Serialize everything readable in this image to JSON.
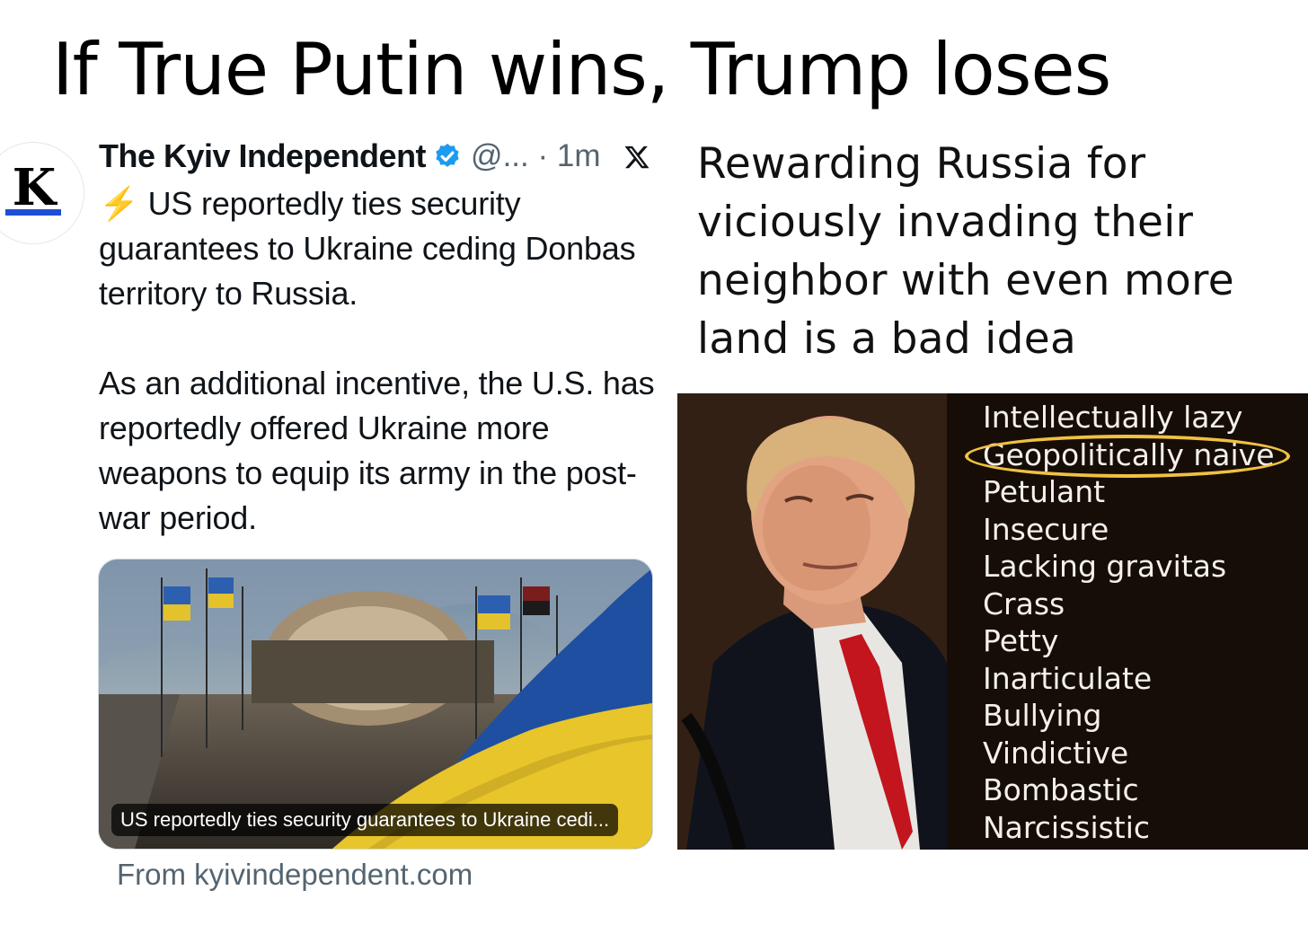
{
  "headline": "If True Putin wins, Trump loses",
  "tweet": {
    "avatar_letter": "K",
    "author": "The Kyiv Independent",
    "handle_time": "@... · 1m",
    "icons": [
      "verified-badge-icon",
      "x-logo-icon",
      "lightning-bolt-icon"
    ],
    "bolt": "⚡",
    "paragraph_1": "US reportedly ties security guarantees to Ukraine ceding Donbas territory to Russia.",
    "paragraph_2": "As an additional incentive, the U.S. has reportedly offered Ukraine more weapons to equip its army in the post-war period.",
    "card": {
      "caption": "US reportedly ties security guarantees to Ukraine cedi...",
      "source": "From kyivindependent.com"
    }
  },
  "quote": "Rewarding Russia for viciously invading their neighbor with even more land is a bad idea",
  "traits": {
    "items": [
      "Intellectually lazy",
      "Geopolitically naive",
      "Petulant",
      "Insecure",
      "Lacking gravitas",
      "Crass",
      "Petty",
      "Inarticulate",
      "Bullying",
      "Vindictive",
      "Bombastic",
      "Narcissistic"
    ],
    "highlight_color": "#f0c142"
  },
  "colors": {
    "verified_blue": "#1d9bf0",
    "secondary_text": "#536471",
    "ukraine_blue": "#1f4fa0",
    "ukraine_yellow": "#e8c52a"
  }
}
